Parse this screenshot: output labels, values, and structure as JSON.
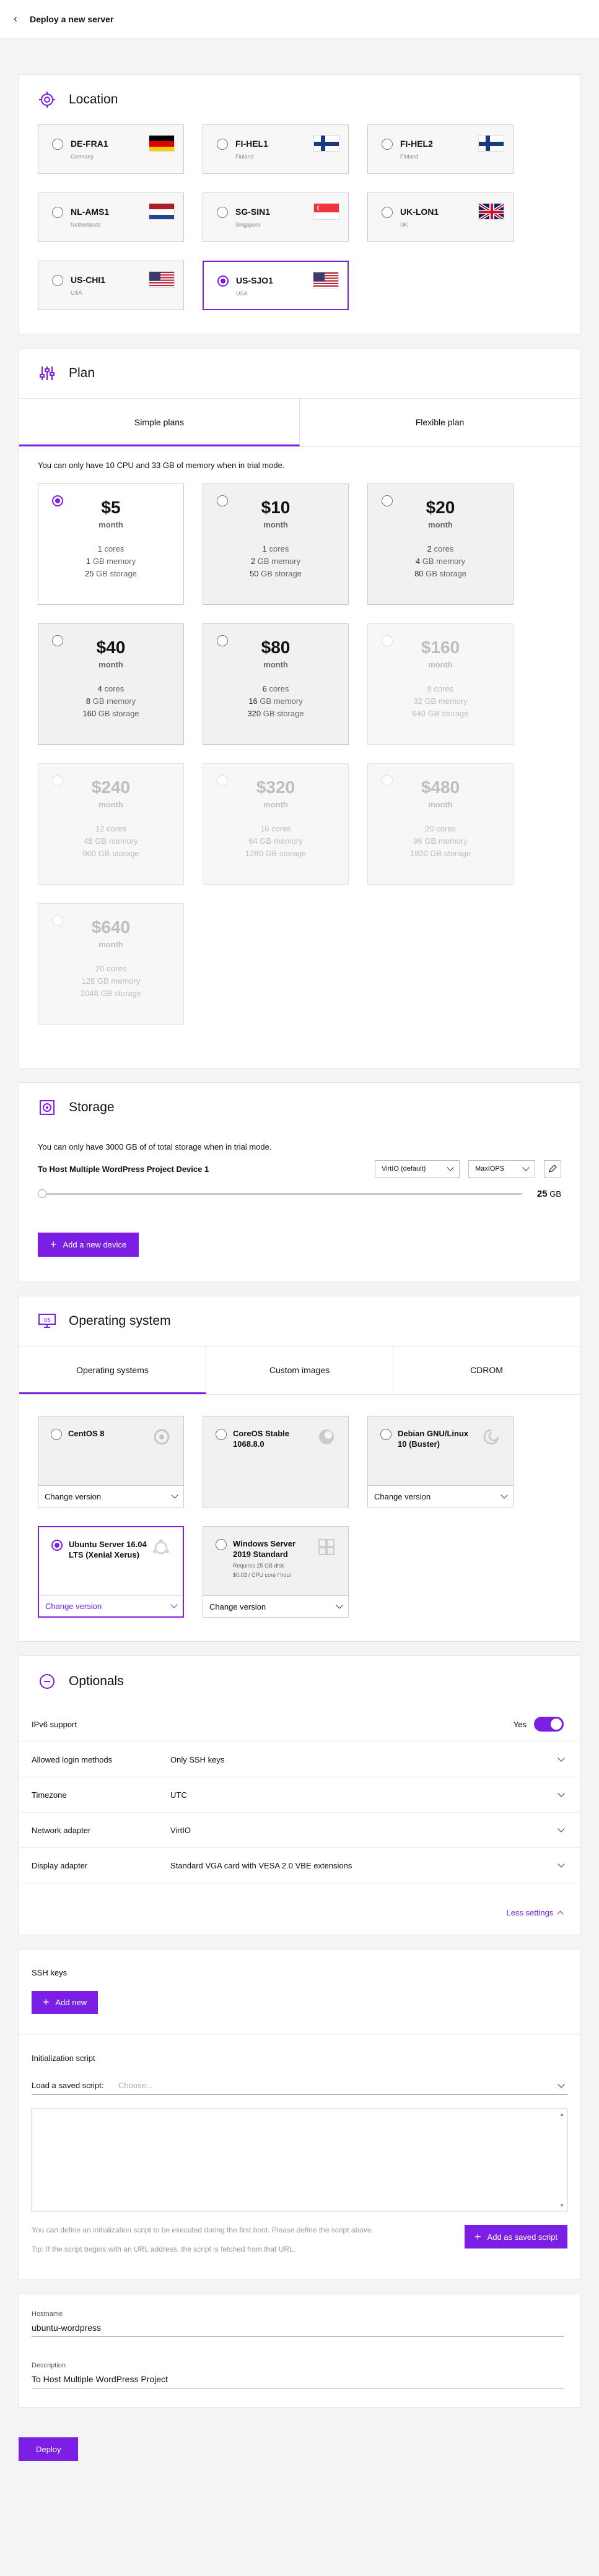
{
  "header": {
    "title": "Deploy a new server"
  },
  "colors": {
    "accent": "#7b1fe4"
  },
  "location": {
    "title": "Location",
    "items": [
      {
        "code": "DE-FRA1",
        "country": "Germany",
        "flag": "de",
        "selected": false
      },
      {
        "code": "FI-HEL1",
        "country": "Finland",
        "flag": "fi",
        "selected": false
      },
      {
        "code": "FI-HEL2",
        "country": "Finland",
        "flag": "fi",
        "selected": false
      },
      {
        "code": "NL-AMS1",
        "country": "Netherlands",
        "flag": "nl",
        "selected": false
      },
      {
        "code": "SG-SIN1",
        "country": "Singapore",
        "flag": "sg",
        "selected": false
      },
      {
        "code": "UK-LON1",
        "country": "UK",
        "flag": "uk",
        "selected": false
      },
      {
        "code": "US-CHI1",
        "country": "USA",
        "flag": "us",
        "selected": false
      },
      {
        "code": "US-SJO1",
        "country": "USA",
        "flag": "us",
        "selected": true
      }
    ]
  },
  "plan": {
    "title": "Plan",
    "tabs": [
      "Simple plans",
      "Flexible plan"
    ],
    "note": "You can only have 10 CPU and 33 GB of memory when in trial mode.",
    "period": "month",
    "items": [
      {
        "price": "$5",
        "cores": "1",
        "memory": "1",
        "storage": "25",
        "selected": true,
        "disabled": false
      },
      {
        "price": "$10",
        "cores": "1",
        "memory": "2",
        "storage": "50",
        "selected": false,
        "disabled": false
      },
      {
        "price": "$20",
        "cores": "2",
        "memory": "4",
        "storage": "80",
        "selected": false,
        "disabled": false
      },
      {
        "price": "$40",
        "cores": "4",
        "memory": "8",
        "storage": "160",
        "selected": false,
        "disabled": false
      },
      {
        "price": "$80",
        "cores": "6",
        "memory": "16",
        "storage": "320",
        "selected": false,
        "disabled": false
      },
      {
        "price": "$160",
        "cores": "8",
        "memory": "32",
        "storage": "640",
        "selected": false,
        "disabled": true
      },
      {
        "price": "$240",
        "cores": "12",
        "memory": "48",
        "storage": "960",
        "selected": false,
        "disabled": true
      },
      {
        "price": "$320",
        "cores": "16",
        "memory": "64",
        "storage": "1280",
        "selected": false,
        "disabled": true
      },
      {
        "price": "$480",
        "cores": "20",
        "memory": "96",
        "storage": "1920",
        "selected": false,
        "disabled": true
      },
      {
        "price": "$640",
        "cores": "20",
        "memory": "128",
        "storage": "2048",
        "selected": false,
        "disabled": true
      }
    ],
    "labels": {
      "cores": "cores",
      "memory": "GB memory",
      "storage": "GB storage"
    }
  },
  "storage": {
    "title": "Storage",
    "note": "You can only have 3000 GB of of total storage when in trial mode.",
    "device_name": "To Host Multiple WordPress Project Device 1",
    "bus": "VirtIO (default)",
    "tier": "MaxIOPS",
    "size": "25",
    "unit": "GB",
    "add_label": "Add a new device"
  },
  "os": {
    "title": "Operating system",
    "tabs": [
      "Operating systems",
      "Custom images",
      "CDROM"
    ],
    "version_label": "Change version",
    "items": [
      {
        "name": "CentOS 8",
        "sub": "",
        "selected": false,
        "has_version": true
      },
      {
        "name": "CoreOS Stable 1068.8.0",
        "sub": "",
        "selected": false,
        "has_version": false
      },
      {
        "name": "Debian GNU/Linux 10 (Buster)",
        "sub": "",
        "selected": false,
        "has_version": true
      },
      {
        "name": "Ubuntu Server 16.04 LTS (Xenial Xerus)",
        "sub": "",
        "selected": true,
        "has_version": true
      },
      {
        "name": "Windows Server 2019 Standard",
        "sub1": "Requires 25 GB disk",
        "sub2": "$0.03 / CPU core / hour",
        "selected": false,
        "has_version": true
      }
    ]
  },
  "optionals": {
    "title": "Optionals",
    "rows": [
      {
        "label": "IPv6 support",
        "value": "",
        "toggle_label": "Yes"
      },
      {
        "label": "Allowed login methods",
        "value": "Only SSH keys"
      },
      {
        "label": "Timezone",
        "value": "UTC"
      },
      {
        "label": "Network adapter",
        "value": "VirtIO"
      },
      {
        "label": "Display adapter",
        "value": "Standard VGA card with VESA 2.0 VBE extensions"
      }
    ],
    "less_label": "Less settings"
  },
  "ssh": {
    "title": "SSH keys",
    "add_label": "Add new"
  },
  "init": {
    "title": "Initialization script",
    "load_label": "Load a saved script:",
    "placeholder": "Choose...",
    "help1": "You can define an initialization script to be executed during the first boot. Please define the script above.",
    "help2": "Tip: If the script begins with an URL address, the script is fetched from that URL.",
    "save_label": "Add as saved script"
  },
  "host": {
    "hostname_label": "Hostname",
    "hostname": "ubuntu-wordpress",
    "description_label": "Description",
    "description": "To Host Multiple WordPress Project"
  },
  "deploy_label": "Deploy"
}
